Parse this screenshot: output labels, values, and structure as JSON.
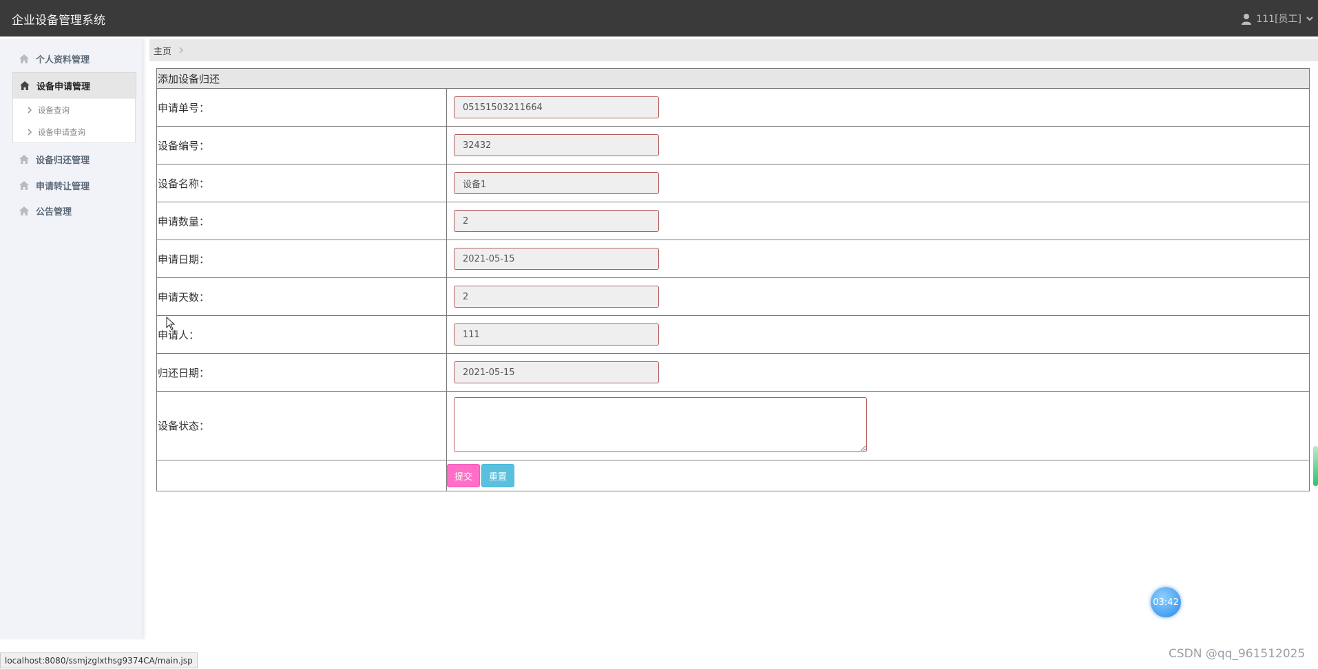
{
  "header": {
    "title": "企业设备管理系统",
    "user_label": "111[员工]"
  },
  "sidebar": {
    "items": [
      {
        "label": "个人资料管理",
        "icon": "home-icon"
      },
      {
        "label": "设备申请管理",
        "icon": "home-icon",
        "active": true
      },
      {
        "label": "设备归还管理",
        "icon": "home-icon"
      },
      {
        "label": "申请转让管理",
        "icon": "home-icon"
      },
      {
        "label": "公告管理",
        "icon": "home-icon"
      }
    ],
    "submenu": [
      {
        "label": "设备查询"
      },
      {
        "label": "设备申请查询"
      }
    ]
  },
  "breadcrumb": {
    "home": "主页"
  },
  "form": {
    "title": "添加设备归还",
    "fields": [
      {
        "label": "申请单号：",
        "value": "05151503211664"
      },
      {
        "label": "设备编号：",
        "value": "32432"
      },
      {
        "label": "设备名称：",
        "value": "设备1"
      },
      {
        "label": "申请数量：",
        "value": "2"
      },
      {
        "label": "申请日期：",
        "value": "2021-05-15"
      },
      {
        "label": "申请天数：",
        "value": "2"
      },
      {
        "label": "申请人：",
        "value": "111"
      },
      {
        "label": "归还日期：",
        "value": "2021-05-15"
      }
    ],
    "status_label": "设备状态：",
    "status_value": "",
    "submit_label": "提交",
    "reset_label": "重置"
  },
  "statusbar": {
    "url": "localhost:8080/ssmjzglxthsg9374CA/main.jsp"
  },
  "timer": "03:42",
  "watermark": "CSDN @qq_961512025",
  "colors": {
    "topbar": "#3a3a3a",
    "submit": "#ff6ec7",
    "reset": "#5bc0de",
    "input_border": "#b35b5b"
  }
}
